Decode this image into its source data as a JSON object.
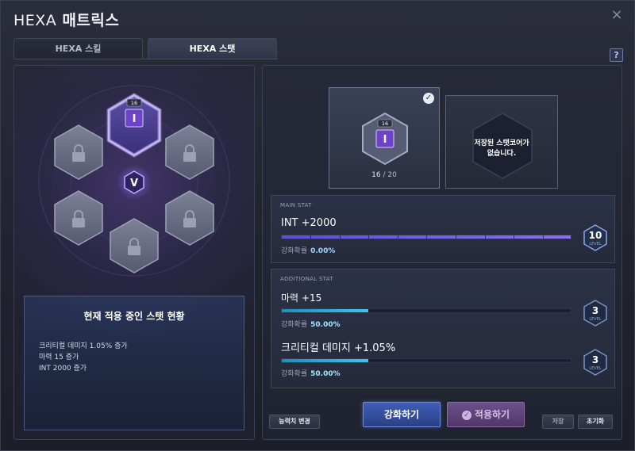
{
  "window": {
    "title_prefix": "HEXA",
    "title_main": "매트릭스",
    "close_icon": "×",
    "help_label": "?"
  },
  "tabs": [
    {
      "label": "HEXA 스킬",
      "active": false
    },
    {
      "label": "HEXA 스탯",
      "active": true
    }
  ],
  "hex_grid": {
    "active_core_level": "16",
    "center_emblem": "V",
    "locked_slots": 5
  },
  "status_panel": {
    "title": "현재 적용 중인 스탯 현황",
    "lines": [
      "크리티컬 데미지 1.05% 증가",
      "마력 15 증가",
      "INT 2000 증가"
    ]
  },
  "core_slots": {
    "equipped": {
      "badge_level": "16",
      "count_current": "16",
      "count_separator": " / ",
      "count_max": "20"
    },
    "saved": {
      "empty_line1": "저장된 스탯코어가",
      "empty_line2": "없습니다."
    }
  },
  "main_stat": {
    "caption": "MAIN STAT",
    "name": "INT +2000",
    "rate_label": "강화확률",
    "rate_value": "0.00%",
    "level": "10",
    "level_word": "LEVEL",
    "progress": 1.0,
    "color": "#6f5ce8"
  },
  "additional_stat": {
    "caption": "ADDITIONAL STAT",
    "items": [
      {
        "name": "마력 +15",
        "rate_label": "강화확률",
        "rate_value": "50.00%",
        "level": "3",
        "level_word": "LEVEL",
        "progress": 0.3
      },
      {
        "name": "크리티컬 데미지 +1.05%",
        "rate_label": "강화확률",
        "rate_value": "50.00%",
        "level": "3",
        "level_word": "LEVEL",
        "progress": 0.3
      }
    ],
    "color": "#2fb6e0"
  },
  "buttons": {
    "change_ability": "능력치 변경",
    "upgrade": "강화하기",
    "apply": "적용하기",
    "apply_check": "✓",
    "save": "저장",
    "reset": "초기화"
  }
}
